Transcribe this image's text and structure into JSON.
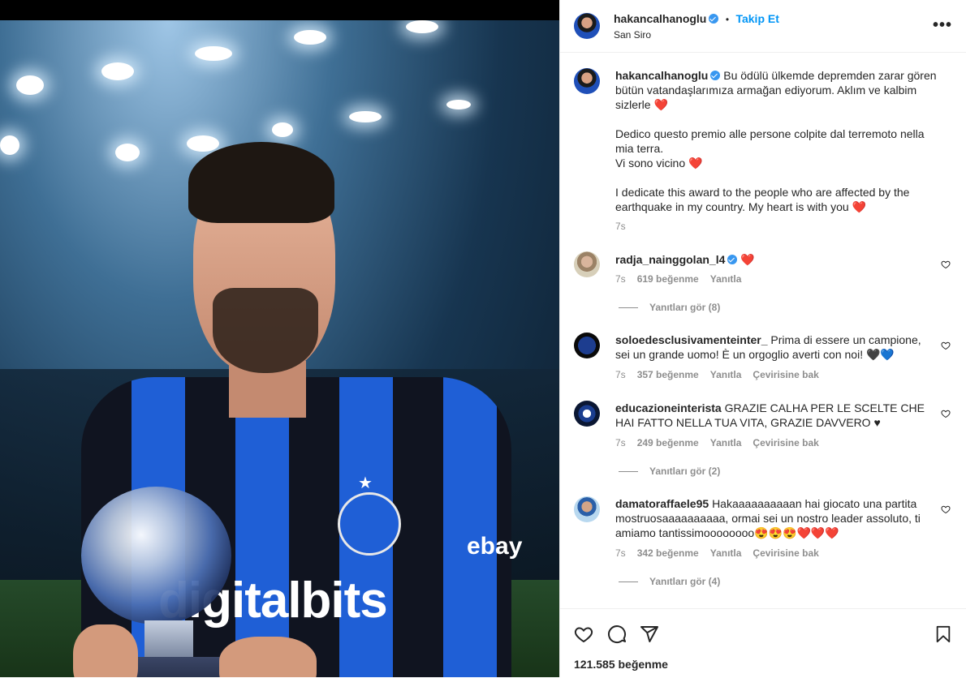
{
  "post": {
    "username": "hakancalhanoglu",
    "follow_label": "Takip Et",
    "separator": "•",
    "location": "San Siro",
    "more_label": "•••",
    "jersey_sponsor": "digitalbits",
    "jersey_brand": "ebay",
    "caption_author": "hakancalhanoglu",
    "caption_text": "Bu ödülü ülkemde depremden zarar gören bütün vatandaşlarımıza armağan ediyorum. Aklım ve kalbim sizlerle ❤️\n\nDedico questo premio alle persone colpite dal terremoto nella mia terra.\nVi sono vicino ❤️\n\nI dedicate this award to the people who are affected by the earthquake in my country. My heart is with you ❤️",
    "caption_time": "7s",
    "likes": "121.585 beğenme"
  },
  "comments": [
    {
      "username": "radja_nainggolan_l4",
      "verified": true,
      "text": "❤️",
      "time": "7s",
      "likes": "619 beğenme",
      "reply": "Yanıtla",
      "translate": "",
      "replies": "Yanıtları gör (8)"
    },
    {
      "username": "soloedesclusivamenteinter_",
      "verified": false,
      "text": "Prima di essere un campione, sei un grande uomo! È un orgoglio averti con noi! 🖤💙",
      "time": "7s",
      "likes": "357 beğenme",
      "reply": "Yanıtla",
      "translate": "Çevirisine bak",
      "replies": ""
    },
    {
      "username": "educazioneinterista",
      "verified": false,
      "text": "GRAZIE CALHA PER LE SCELTE CHE HAI FATTO NELLA TUA VITA, GRAZIE DAVVERO ♥",
      "time": "7s",
      "likes": "249 beğenme",
      "reply": "Yanıtla",
      "translate": "Çevirisine bak",
      "replies": "Yanıtları gör (2)"
    },
    {
      "username": "damatoraffaele95",
      "verified": false,
      "text": "Hakaaaaaaaaaan hai giocato una partita mostruosaaaaaaaaaa, ormai sei un nostro leader assoluto, ti amiamo tantissimoooooooo😍😍😍❤️❤️❤️",
      "time": "7s",
      "likes": "342 beğenme",
      "reply": "Yanıtla",
      "translate": "Çevirisine bak",
      "replies": "Yanıtları gör (4)"
    }
  ],
  "icons": {
    "like": "heart-icon",
    "comment": "comment-icon",
    "share": "share-icon",
    "save": "bookmark-icon",
    "verified": "verified-badge-icon"
  },
  "colors": {
    "accent": "#0095f6",
    "verified": "#3897f0",
    "heart": "#ed4956",
    "muted": "#8e8e8e"
  }
}
